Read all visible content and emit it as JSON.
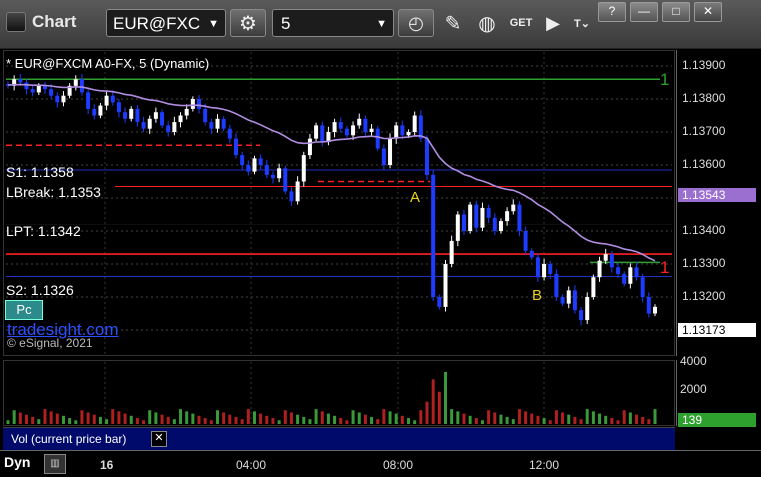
{
  "toolbar": {
    "app_title": "Chart",
    "symbol": "EUR@FXC",
    "interval": "5",
    "get_label": "GET",
    "window_controls": [
      "?",
      "—",
      "□",
      "✕"
    ]
  },
  "chart": {
    "title": "* EUR@FXCM A0-FX, 5 (Dynamic)",
    "levels": {
      "s1": "S1: 1.1358",
      "lbreak": "LBreak: 1.1353",
      "lpt": "LPT: 1.1342",
      "s2": "S2: 1.1326"
    },
    "markers": {
      "a": "A",
      "b": "B",
      "one_top": "1",
      "one_mid": "1"
    },
    "watermark": "tradesight.com",
    "copyright": "© eSignal, 2021",
    "pc_button": "Pc",
    "price_axis": [
      "1.13900",
      "1.13800",
      "1.13700",
      "1.13600",
      "1.13500",
      "1.13400",
      "1.13300",
      "1.13200",
      "1.13100"
    ],
    "last_price_tag": "1.13543",
    "current_price_tag": "1.13173",
    "colors": {
      "bull_candle": "#ffffff",
      "bear_candle": "#1e3cff",
      "ma": "#b08de0",
      "support": "#ff2020",
      "resist": "#2ea02e",
      "tradesight": "#2f4fff"
    }
  },
  "volume": {
    "legend": "Vol (current price bar)",
    "axis": [
      "4000",
      "2000"
    ],
    "current_tag": "139"
  },
  "time_axis": {
    "mode": "Dyn",
    "labels": [
      "16",
      "04:00",
      "08:00",
      "12:00"
    ]
  },
  "chart_data": {
    "type": "candlestick",
    "title": "* EUR@FXCM A0-FX, 5 (Dynamic)",
    "ylim": [
      1.1308,
      1.1395
    ],
    "support_levels": [
      1.1358,
      1.1353,
      1.1342,
      1.1326
    ],
    "closes": [
      1.1384,
      1.1386,
      1.1385,
      1.1383,
      1.1382,
      1.1384,
      1.1383,
      1.1381,
      1.1379,
      1.1381,
      1.1384,
      1.1386,
      1.1382,
      1.1377,
      1.1375,
      1.1378,
      1.1381,
      1.1379,
      1.1376,
      1.1374,
      1.1377,
      1.1373,
      1.1371,
      1.1374,
      1.1376,
      1.1372,
      1.137,
      1.1373,
      1.1375,
      1.1377,
      1.138,
      1.1377,
      1.1373,
      1.1371,
      1.1374,
      1.1371,
      1.1368,
      1.1363,
      1.136,
      1.1358,
      1.1362,
      1.136,
      1.1357,
      1.1356,
      1.1359,
      1.1352,
      1.1349,
      1.1355,
      1.1363,
      1.1368,
      1.1372,
      1.1367,
      1.137,
      1.1373,
      1.1371,
      1.1369,
      1.1372,
      1.1374,
      1.137,
      1.1371,
      1.1365,
      1.136,
      1.1368,
      1.1372,
      1.1369,
      1.137,
      1.1375,
      1.1368,
      1.1357,
      1.132,
      1.1317,
      1.133,
      1.1337,
      1.1345,
      1.134,
      1.1348,
      1.1341,
      1.1347,
      1.1344,
      1.134,
      1.1343,
      1.1346,
      1.1348,
      1.134,
      1.1334,
      1.1332,
      1.1326,
      1.133,
      1.1327,
      1.132,
      1.1318,
      1.1322,
      1.1316,
      1.1313,
      1.132,
      1.1326,
      1.1331,
      1.1333,
      1.1329,
      1.1327,
      1.1324,
      1.1329,
      1.1326,
      1.132,
      1.1315,
      1.1317
    ]
  }
}
